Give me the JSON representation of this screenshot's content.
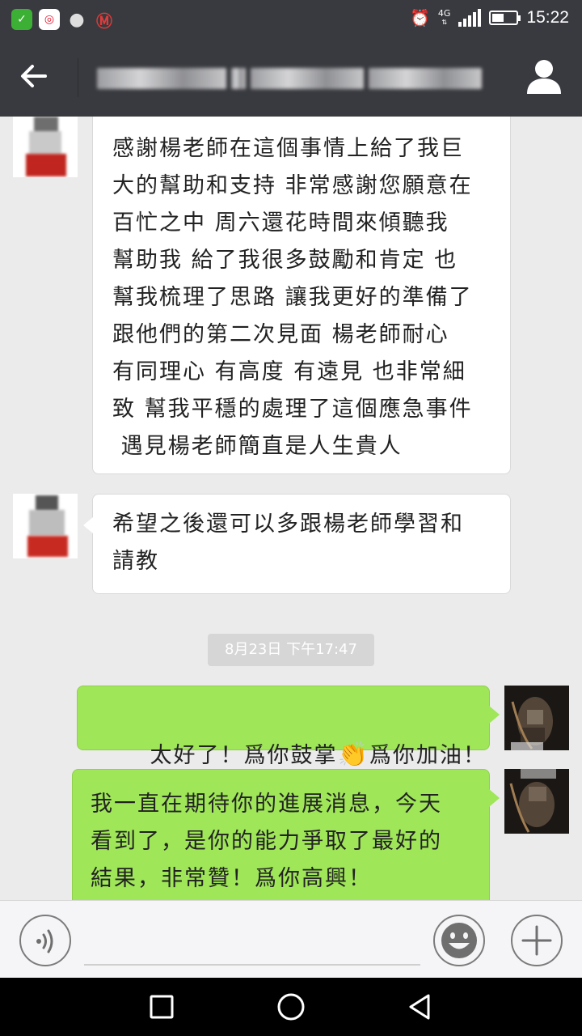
{
  "status_bar": {
    "network": "4G",
    "time": "15:22",
    "battery_level": 0.5,
    "apps": [
      {
        "icon": "wechat-app-icon",
        "color": "#3cb034"
      },
      {
        "icon": "weibo-app-icon",
        "color": "#e6162d"
      },
      {
        "icon": "message-app-icon",
        "color": "#dddddd"
      },
      {
        "icon": "bank-app-icon",
        "color": "#e03a3a"
      }
    ]
  },
  "header": {
    "back_icon": "back-arrow-icon",
    "contact_icon": "contact-profile-icon"
  },
  "messages": [
    {
      "sender": "contact",
      "text": "感謝楊老師在這個事情上給了我巨\n大的幫助和支持 非常感謝您願意在\n百忙之中 周六還花時間來傾聽我\n幫助我 給了我很多鼓勵和肯定 也\n幫我梳理了思路 讓我更好的準備了\n跟他們的第二次見面 楊老師耐心\n有同理心 有高度 有遠見 也非常細\n致 幫我平穩的處理了這個應急事件\n 遇見楊老師簡直是人生貴人"
    },
    {
      "sender": "contact",
      "text": "希望之後還可以多跟楊老師學習和\n請教"
    },
    {
      "sender": "me",
      "text_before_emoji": "太好了！爲你鼓掌",
      "emoji": "👏",
      "text_after_emoji": "爲你加油！"
    },
    {
      "sender": "me",
      "text": "我一直在期待你的進展消息，今天\n看到了，是你的能力爭取了最好的\n結果，非常贊！爲你高興！"
    }
  ],
  "timestamp": "8月23日 下午17:47",
  "input_bar": {
    "voice_icon": "voice-input-icon",
    "emoji_icon": "emoji-icon",
    "more_icon": "plus-icon"
  },
  "nav_bar": {
    "recents_icon": "recents-square-icon",
    "home_icon": "home-circle-icon",
    "back_icon": "back-triangle-icon"
  },
  "colors": {
    "header_bg": "#393a3f",
    "chat_bg": "#ebebeb",
    "outgoing_bubble": "#9fe658",
    "incoming_bubble": "#ffffff"
  }
}
